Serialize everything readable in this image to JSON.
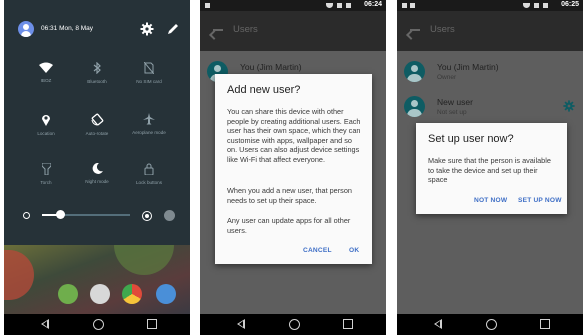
{
  "panel1": {
    "quick_settings": {
      "time": "06:31 Mon, 8 May",
      "tiles": [
        {
          "label": "IBOZ",
          "icon": "wifi-icon"
        },
        {
          "label": "Bluetooth",
          "icon": "bluetooth-icon"
        },
        {
          "label": "No SIM card",
          "icon": "no-sim-icon"
        },
        {
          "label": "Location",
          "icon": "location-icon"
        },
        {
          "label": "Auto-rotate",
          "icon": "auto-rotate-icon"
        },
        {
          "label": "Aeroplane mode",
          "icon": "airplane-icon"
        },
        {
          "label": "Torch",
          "icon": "flashlight-icon"
        },
        {
          "label": "Night mode",
          "icon": "night-mode-icon"
        },
        {
          "label": "Lock buttons",
          "icon": "lock-icon"
        }
      ],
      "brightness_fraction": 0.2
    }
  },
  "panel2": {
    "status_time": "06:24",
    "title": "Users",
    "user": {
      "name": "You (Jim Martin)"
    },
    "dialog": {
      "title": "Add new user?",
      "paragraphs": [
        "You can share this device with other people by creating additional users. Each user has their own space, which they can customise with apps, wallpaper and so on. Users can also adjust device settings like Wi-Fi that affect everyone.",
        "When you add a new user, that person needs to set up their space.",
        "Any user can update apps for all other users."
      ],
      "cancel": "CANCEL",
      "ok": "OK"
    }
  },
  "panel3": {
    "status_time": "06:25",
    "title": "Users",
    "users": [
      {
        "name": "You (Jim Martin)",
        "role": "Owner"
      },
      {
        "name": "New user",
        "role": "Not set up"
      }
    ],
    "dialog": {
      "title": "Set up user now?",
      "body": "Make sure that the person is available to take the device and set up their space",
      "not_now": "NOT NOW",
      "setup_now": "SET UP NOW"
    }
  },
  "colors": {
    "accent": "#3f6fc6",
    "qs_bg": "#263238",
    "avatar": "#0e5c63"
  }
}
